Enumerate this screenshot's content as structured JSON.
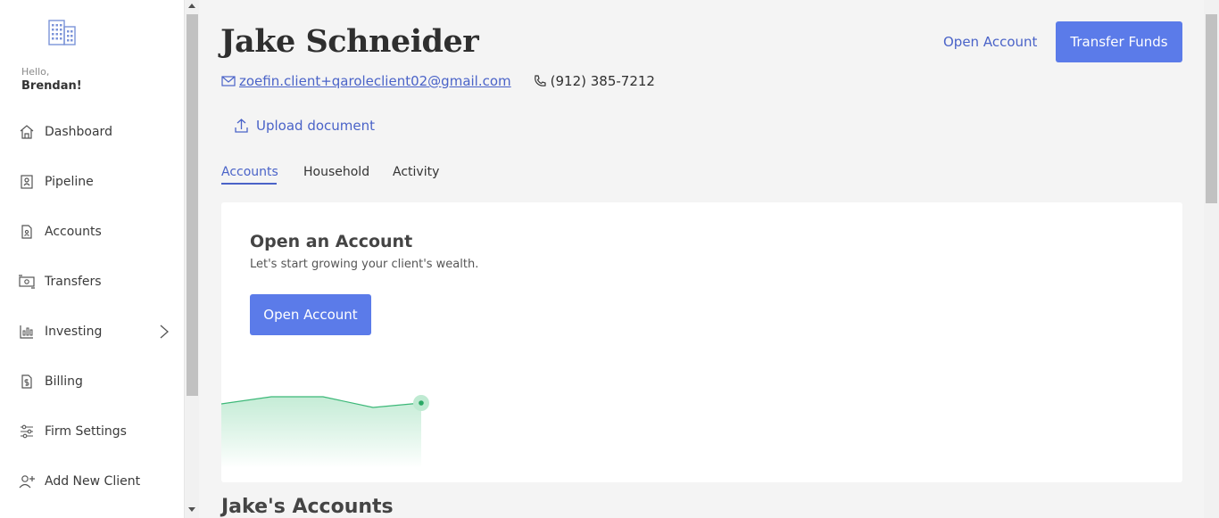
{
  "sidebar": {
    "greeting": "Hello,",
    "user_name": "Brendan!",
    "items": [
      {
        "label": "Dashboard",
        "icon": "home-icon"
      },
      {
        "label": "Pipeline",
        "icon": "pipeline-icon"
      },
      {
        "label": "Accounts",
        "icon": "accounts-icon"
      },
      {
        "label": "Transfers",
        "icon": "transfers-icon"
      },
      {
        "label": "Investing",
        "icon": "investing-icon"
      },
      {
        "label": "Billing",
        "icon": "billing-icon"
      },
      {
        "label": "Firm Settings",
        "icon": "sliders-icon"
      },
      {
        "label": "Add New Client",
        "icon": "add-user-icon"
      }
    ]
  },
  "header": {
    "client_name": "Jake Schneider",
    "email": "zoefin.client+qaroleclient02@gmail.com",
    "phone": "(912) 385-7212",
    "open_account_label": "Open Account",
    "transfer_funds_label": "Transfer Funds",
    "upload_label": "Upload document"
  },
  "tabs": [
    {
      "label": "Accounts",
      "active": true
    },
    {
      "label": "Household",
      "active": false
    },
    {
      "label": "Activity",
      "active": false
    }
  ],
  "card": {
    "title": "Open an Account",
    "subtitle": "Let's start growing your client's wealth.",
    "button_label": "Open Account"
  },
  "accounts_section_title": "Jake's Accounts",
  "colors": {
    "accent": "#5b7be9",
    "link": "#4a63c8",
    "sparkline": "#3cb878"
  }
}
